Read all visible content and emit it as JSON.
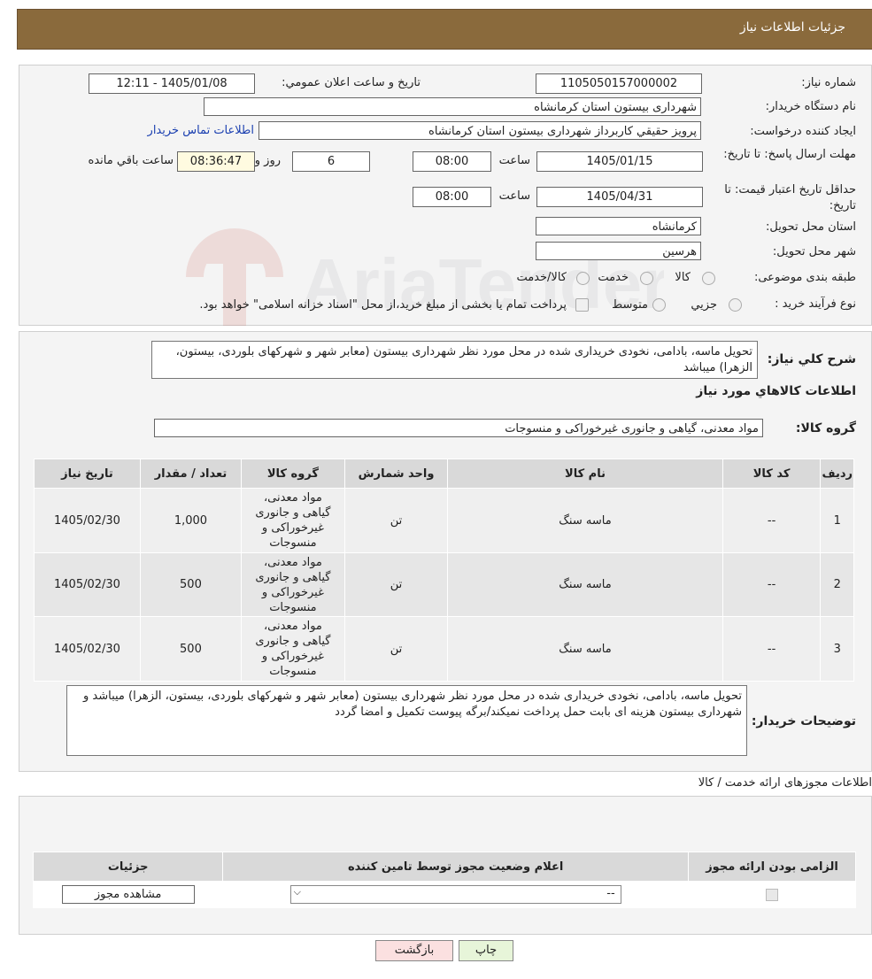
{
  "header": {
    "title": "جزئیات اطلاعات نیاز"
  },
  "form": {
    "need_number_label": "شماره نیاز:",
    "need_number": "1105050157000002",
    "announce_label": "تاریخ و ساعت اعلان عمومي:",
    "announce_value": "1405/01/08 - 12:11",
    "buyer_org_label": "نام دستگاه خریدار:",
    "buyer_org": "شهرداری بیستون استان کرمانشاه",
    "creator_label": "ایجاد کننده درخواست:",
    "creator": "پرويز حقيقي کاربرداز شهرداری بیستون استان کرمانشاه",
    "contact_link": "اطلاعات تماس خریدار",
    "deadline_label": "مهلت ارسال پاسخ: تا تاریخ:",
    "deadline_date": "1405/01/15",
    "time_label": "ساعت",
    "deadline_time": "08:00",
    "days_value": "6",
    "days_label": "روز و",
    "remaining_time": "08:36:47",
    "remaining_label": "ساعت باقي مانده",
    "validity_label": "حداقل تاریخ اعتبار قیمت: تا تاریخ:",
    "validity_date": "1405/04/31",
    "validity_time": "08:00",
    "province_label": "استان محل تحویل:",
    "province": "کرمانشاه",
    "city_label": "شهر محل تحویل:",
    "city": "هرسین",
    "category_label": "طبقه بندی موضوعی:",
    "category_options": [
      "کالا",
      "خدمت",
      "کالا/خدمت"
    ],
    "process_label": "نوع فرآیند خرید :",
    "process_options": [
      "جزیي",
      "متوسط"
    ],
    "process_note": "پرداخت تمام یا بخشی از مبلغ خرید،از محل \"اسناد خزانه اسلامی\" خواهد بود."
  },
  "summary": {
    "label": "شرح کلي نياز:",
    "text": "تحویل ماسه، بادامی، نخودی خریداری شده در محل مورد نظر شهرداری بیستون (معابر شهر و شهرکهای بلوردی، بیستون، الزهرا) میباشد",
    "goods_info_title": "اطلاعات کالاهاي مورد نياز",
    "group_label": "گروه کالا:",
    "group_value": "مواد معدنی، گیاهی و جانوری غیرخوراکی و منسوجات"
  },
  "goods_table": {
    "headers": [
      "ردیف",
      "کد کالا",
      "نام کالا",
      "واحد شمارش",
      "گروه کالا",
      "تعداد / مقدار",
      "تاریخ نیاز"
    ],
    "rows": [
      {
        "idx": "1",
        "code": "--",
        "name": "ماسه سنگ",
        "unit": "تن",
        "group": "مواد معدنی، گیاهی و جانوری غیرخوراکی و منسوجات",
        "qty": "1,000",
        "date": "1405/02/30"
      },
      {
        "idx": "2",
        "code": "--",
        "name": "ماسه سنگ",
        "unit": "تن",
        "group": "مواد معدنی، گیاهی و جانوری غیرخوراکی و منسوجات",
        "qty": "500",
        "date": "1405/02/30"
      },
      {
        "idx": "3",
        "code": "--",
        "name": "ماسه سنگ",
        "unit": "تن",
        "group": "مواد معدنی، گیاهی و جانوری غیرخوراکی و منسوجات",
        "qty": "500",
        "date": "1405/02/30"
      }
    ]
  },
  "buyer_notes": {
    "label": "توضیحات خریدار:",
    "text": "تحویل ماسه، بادامی، نخودی خریداری شده در محل مورد نظر شهرداری بیستون (معابر شهر و شهرکهای بلوردی، بیستون، الزهرا) میباشد و شهرداری بیستون هزینه ای بابت حمل پرداخت نمیکند/برگه پیوست تکمیل و امضا گردد"
  },
  "permits": {
    "title": "اطلاعات مجوزهای ارائه خدمت / کالا",
    "headers": [
      "الزامی بودن ارائه مجوز",
      "اعلام وضعیت مجوز توسط تامین کننده",
      "جزئیات"
    ],
    "select_value": "--",
    "view_button": "مشاهده مجوز"
  },
  "buttons": {
    "print": "چاپ",
    "back": "بازگشت"
  },
  "watermark": "AriaTender.neT"
}
